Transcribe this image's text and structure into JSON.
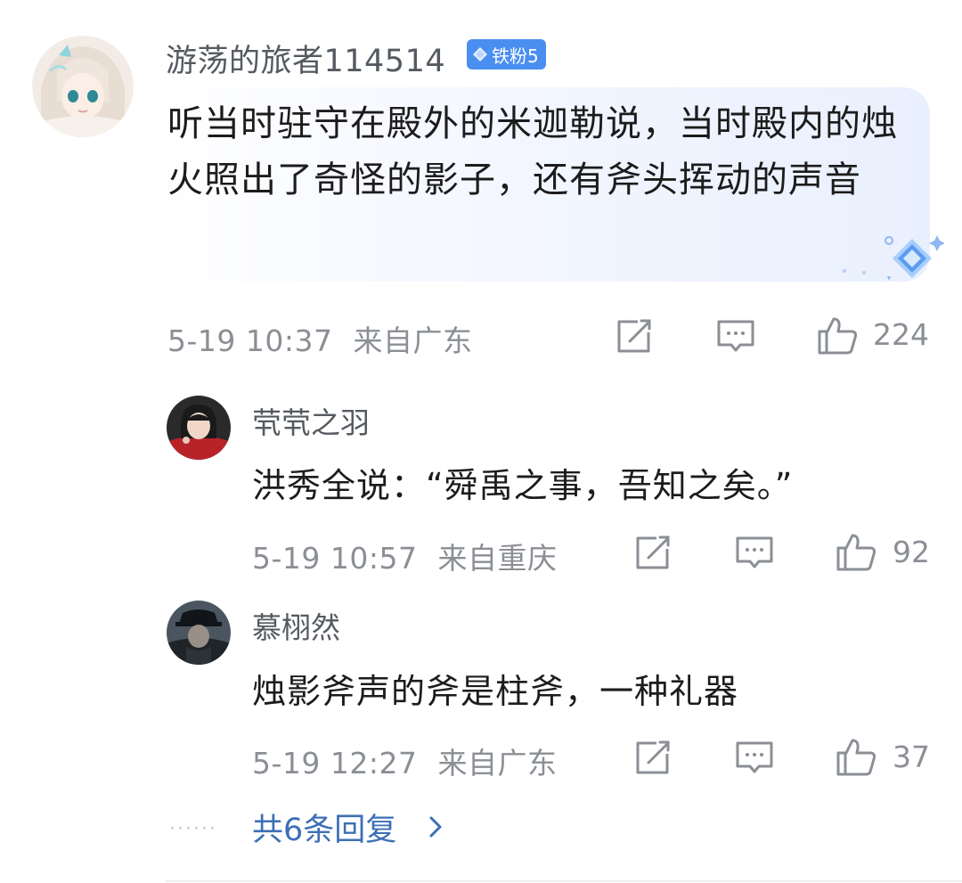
{
  "main_comment": {
    "username": "游荡的旅者114514",
    "badge_label": "铁粉5",
    "text": "听当时驻守在殿外的米迦勒说，当时殿内的烛火照出了奇怪的影子，还有斧头挥动的声音",
    "timestamp": "5-19 10:37",
    "location": "来自广东",
    "like_count": "224",
    "icons": [
      "share-icon",
      "reply-icon",
      "like-icon"
    ]
  },
  "replies": [
    {
      "username": "茕茕之羽",
      "text": "洪秀全说：“舜禹之事，吾知之矣。”",
      "timestamp": "5-19 10:57",
      "location": "来自重庆",
      "like_count": "92"
    },
    {
      "username": "慕栩然",
      "text": "烛影斧声的斧是柱斧，一种礼器",
      "timestamp": "5-19 12:27",
      "location": "来自广东",
      "like_count": "37"
    }
  ],
  "more_replies": {
    "dots": "······",
    "label": "共6条回复"
  },
  "colors": {
    "meta": "#8b8f95",
    "link": "#3d6fb6",
    "badge": "#4a8ff0",
    "bubble": "#eef3fe"
  }
}
